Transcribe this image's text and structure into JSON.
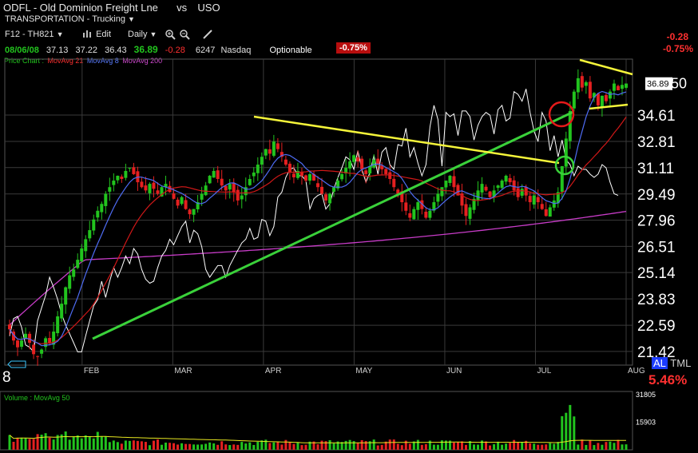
{
  "header": {
    "symbol": "ODFL",
    "company": "Old Dominion Freight Lne",
    "vs_label": "vs",
    "compare_symbol": "USO",
    "sector": "TRANSPORTATION - Trucking",
    "sector_arrow": "▼",
    "chart_set": "F12 - TH821",
    "edit_label": "Edit",
    "period": "Daily",
    "quote": {
      "date": "08/06/08",
      "open": "37.13",
      "high": "37.22",
      "low": "36.43",
      "close": "36.89",
      "change": "-0.28",
      "volume": "6247",
      "exchange": "Nasdaq",
      "optionable": "Optionable",
      "pct_change": "-0.75%"
    },
    "right_change": "-0.28",
    "right_pct": "-0.75%"
  },
  "legend": {
    "price_chart": "Price Chart :",
    "ma21": "MovAvg 21",
    "ma8": "MovAvg 8",
    "ma200": "MovAvg 200",
    "volume": "Volume : MovAvg 50"
  },
  "footer": {
    "al_badge": "AL",
    "tml": "TML",
    "rel_pct": "5.46%",
    "left_digit": "8"
  },
  "colors": {
    "up": "#22c41e",
    "down": "#e52020",
    "ma21": "#d01818",
    "ma8": "#4e6cf4",
    "ma200": "#c83cc8",
    "compare": "#ffffff",
    "trend_green": "#3ad13a",
    "trend_yellow": "#f5f53a",
    "grid": "#3a3a3a",
    "negative_text": "#ff3030"
  },
  "chart_data": {
    "type": "candlestick",
    "y_ticks": [
      "34.61",
      "32.81",
      "31.11",
      "29.49",
      "27.96",
      "26.51",
      "25.14",
      "23.83",
      "22.59",
      "21.42"
    ],
    "y_scale": "log",
    "ylim": [
      20.9,
      38.4
    ],
    "last_price_label": "36.89",
    "partial_tick_label": "36.50",
    "x_labels": [
      "FEB",
      "MAR",
      "APR",
      "MAY",
      "JUN",
      "JUL",
      "AUG"
    ],
    "volume_ticks": [
      "31805",
      "15903"
    ],
    "grid": true,
    "closes": [
      22.4,
      21.9,
      21.6,
      21.9,
      22.2,
      21.8,
      21.3,
      21.2,
      21.5,
      22.0,
      21.8,
      22.3,
      23.0,
      23.6,
      24.4,
      25.0,
      25.3,
      25.8,
      26.4,
      26.9,
      27.4,
      28.0,
      28.5,
      28.9,
      29.5,
      29.9,
      30.3,
      30.6,
      30.4,
      30.9,
      31.1,
      30.7,
      30.2,
      29.9,
      29.7,
      30.1,
      29.8,
      29.5,
      29.9,
      30.1,
      29.6,
      29.2,
      28.8,
      29.3,
      28.6,
      28.3,
      28.6,
      29.0,
      29.5,
      30.0,
      30.6,
      30.9,
      30.4,
      30.0,
      29.7,
      30.1,
      29.6,
      29.1,
      29.4,
      29.9,
      30.4,
      30.8,
      31.3,
      31.8,
      32.3,
      32.0,
      32.8,
      32.3,
      31.8,
      31.3,
      30.8,
      30.5,
      30.9,
      30.6,
      30.3,
      30.7,
      30.3,
      29.9,
      29.5,
      29.1,
      29.5,
      29.9,
      30.3,
      30.7,
      31.1,
      31.5,
      31.9,
      31.5,
      31.0,
      30.7,
      31.2,
      31.6,
      31.3,
      31.0,
      30.7,
      30.4,
      29.9,
      29.5,
      29.0,
      28.5,
      28.1,
      28.6,
      29.0,
      28.6,
      28.1,
      28.5,
      29.0,
      29.5,
      29.9,
      30.3,
      30.6,
      29.9,
      29.4,
      28.8,
      28.2,
      28.7,
      29.2,
      29.7,
      30.1,
      29.7,
      29.3,
      29.7,
      30.0,
      30.3,
      30.6,
      30.2,
      29.7,
      29.3,
      29.8,
      29.4,
      29.0,
      29.4,
      29.0,
      28.6,
      28.2,
      28.7,
      29.1,
      29.6,
      31.2,
      33.0,
      34.9,
      36.3,
      37.3,
      36.6,
      37.0,
      35.8,
      36.2,
      35.3,
      36.0,
      35.6,
      36.3,
      36.9,
      36.4,
      36.8,
      36.9
    ],
    "compare_series": [
      22.1,
      22.9,
      23.0,
      22.5,
      21.7,
      21.6,
      21.4,
      22.8,
      23.4,
      24.0,
      24.9,
      24.4,
      23.8,
      23.1,
      22.6,
      22.2,
      21.8,
      21.4,
      21.4,
      22.1,
      22.8,
      23.5,
      23.8,
      24.7,
      23.9,
      24.7,
      25.4,
      24.9,
      25.4,
      26.0,
      25.6,
      26.4,
      26.1,
      25.3,
      24.8,
      24.6,
      24.7,
      25.4,
      26.0,
      26.3,
      26.9,
      26.6,
      27.1,
      27.6,
      27.9,
      26.7,
      27.4,
      27.2,
      26.5,
      25.3,
      24.9,
      25.2,
      25.5,
      25.5,
      24.9,
      25.5,
      25.9,
      26.3,
      26.7,
      26.9,
      27.5,
      26.9,
      27.0,
      28.0,
      27.9,
      27.1,
      27.6,
      29.3,
      29.6,
      30.5,
      31.0,
      31.1,
      30.6,
      30.6,
      30.3,
      28.6,
      29.2,
      29.4,
      29.5,
      28.6,
      28.9,
      29.8,
      30.5,
      31.1,
      31.8,
      31.6,
      31.0,
      32.2,
      31.0,
      30.2,
      30.8,
      31.9,
      30.7,
      32.1,
      32.4,
      31.3,
      31.0,
      32.6,
      32.5,
      33.7,
      31.8,
      32.4,
      31.4,
      30.6,
      31.3,
      33.8,
      35.3,
      34.3,
      31.2,
      34.8,
      34.5,
      34.7,
      33.2,
      34.9,
      34.9,
      34.5,
      32.9,
      33.9,
      34.5,
      34.8,
      34.6,
      33.3,
      35.0,
      35.3,
      34.2,
      34.4,
      36.3,
      36.1,
      35.6,
      36.5,
      34.8,
      33.5,
      32.8,
      34.8,
      34.2,
      32.2,
      33.2,
      31.8,
      32.9,
      31.6,
      31.3,
      30.6,
      31.2,
      31.0,
      31.0,
      30.7,
      30.5,
      30.7,
      31.3,
      31.1,
      30.2,
      29.5,
      29.4
    ]
  }
}
